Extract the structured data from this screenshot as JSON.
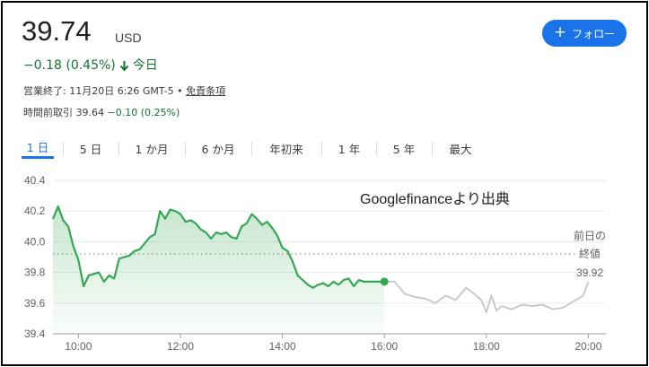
{
  "quote": {
    "price": "39.74",
    "currency": "USD",
    "change": "−0.18 (0.45%)",
    "period": "今日",
    "close_prefix": "営業終了: 11月20日 6:26 GMT-5 • ",
    "disclaimer_link": "免責条項",
    "premarket_label": "時間前取引 39.64",
    "premarket_change": "−0.10 (0.25%)"
  },
  "follow_button": {
    "label": "フォロー"
  },
  "tabs": [
    "1 日",
    "5 日",
    "1 か月",
    "6 か月",
    "年初来",
    "1 年",
    "5 年",
    "最大"
  ],
  "colors": {
    "accent": "#1a73e8",
    "up_down_green": "#137333",
    "line_green": "#34a853",
    "forecast_gray": "#c4c7ca"
  },
  "chart_data": {
    "type": "line",
    "watermark": "Googlefinanceより出典",
    "xlim": [
      "09:30",
      "20:00"
    ],
    "ylim": [
      39.4,
      40.4
    ],
    "y_ticks": [
      "40.4",
      "40.2",
      "40.0",
      "39.8",
      "39.6",
      "39.4"
    ],
    "x_ticks": [
      "10:00",
      "12:00",
      "14:00",
      "16:00",
      "18:00",
      "20:00"
    ],
    "previous_close": {
      "label_line1": "前日の",
      "label_line2": "終値",
      "value": "39.92",
      "y": 39.92
    },
    "series": [
      {
        "type": "area",
        "x": [
          "09:30",
          "09:36",
          "09:42",
          "09:48",
          "09:54",
          "10:00",
          "10:06",
          "10:12",
          "10:18",
          "10:24",
          "10:30",
          "10:36",
          "10:42",
          "10:48",
          "10:54",
          "11:00",
          "11:06",
          "11:12",
          "11:18",
          "11:24",
          "11:30",
          "11:36",
          "11:42",
          "11:48",
          "11:54",
          "12:00",
          "12:06",
          "12:12",
          "12:18",
          "12:24",
          "12:30",
          "12:36",
          "12:42",
          "12:48",
          "12:54",
          "13:00",
          "13:06",
          "13:12",
          "13:18",
          "13:24",
          "13:30",
          "13:36",
          "13:42",
          "13:48",
          "13:54",
          "14:00",
          "14:06",
          "14:12",
          "14:18",
          "14:24",
          "14:30",
          "14:36",
          "14:42",
          "14:48",
          "14:54",
          "15:00",
          "15:06",
          "15:12",
          "15:18",
          "15:24",
          "15:30",
          "15:36",
          "15:42",
          "15:48",
          "15:54",
          "16:00"
        ],
        "y": [
          40.15,
          40.23,
          40.14,
          40.1,
          39.97,
          39.88,
          39.71,
          39.78,
          39.79,
          39.8,
          39.74,
          39.78,
          39.76,
          39.89,
          39.9,
          39.91,
          39.94,
          39.95,
          39.99,
          40.03,
          40.05,
          40.2,
          40.15,
          40.21,
          40.2,
          40.18,
          40.13,
          40.14,
          40.12,
          40.08,
          40.06,
          40.02,
          40.06,
          40.05,
          40.06,
          40.03,
          40.02,
          40.1,
          40.12,
          40.18,
          40.15,
          40.11,
          40.13,
          40.09,
          40.04,
          39.96,
          39.94,
          39.87,
          39.78,
          39.75,
          39.72,
          39.7,
          39.72,
          39.73,
          39.71,
          39.74,
          39.72,
          39.75,
          39.76,
          39.71,
          39.75,
          39.74,
          39.74,
          39.74,
          39.74,
          39.74
        ]
      },
      {
        "type": "line",
        "x": [
          "16:00",
          "16:12",
          "16:24",
          "16:36",
          "16:48",
          "17:00",
          "17:12",
          "17:24",
          "17:36",
          "17:48",
          "17:54",
          "18:00",
          "18:06",
          "18:12",
          "18:18",
          "18:30",
          "18:42",
          "18:54",
          "19:06",
          "19:18",
          "19:30",
          "19:42",
          "19:54",
          "20:00"
        ],
        "y": [
          39.74,
          39.74,
          39.66,
          39.64,
          39.63,
          39.6,
          39.65,
          39.62,
          39.7,
          39.65,
          39.62,
          39.54,
          39.65,
          39.55,
          39.58,
          39.56,
          39.59,
          39.58,
          39.59,
          39.56,
          39.57,
          39.61,
          39.65,
          39.74
        ]
      }
    ]
  }
}
